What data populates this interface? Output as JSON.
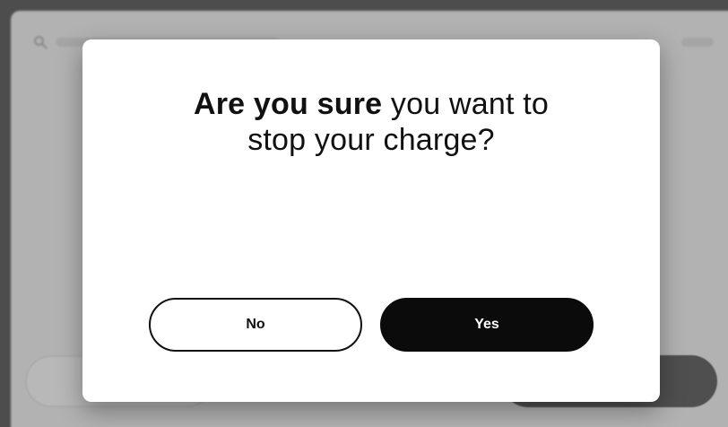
{
  "modal": {
    "title_bold": "Are you sure",
    "title_rest_line1": "you want to",
    "title_line2": "stop your charge?"
  },
  "buttons": {
    "no_label": "No",
    "yes_label": "Yes"
  },
  "background": {
    "search_icon": "search-icon"
  }
}
